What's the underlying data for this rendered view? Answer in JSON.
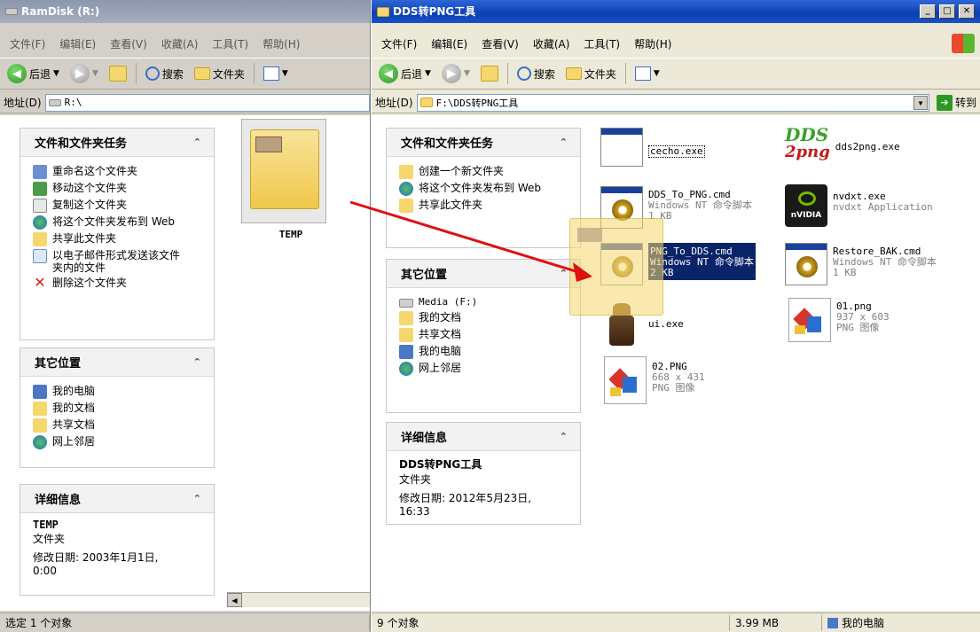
{
  "left_window": {
    "title": "RamDisk (R:)",
    "menu": [
      "文件(F)",
      "编辑(E)",
      "查看(V)",
      "收藏(A)",
      "工具(T)",
      "帮助(H)"
    ],
    "toolbar": {
      "back": "后退",
      "search": "搜索",
      "folders": "文件夹"
    },
    "address_label": "地址(D)",
    "address": "R:\\",
    "tasks_panel": {
      "title": "文件和文件夹任务",
      "items": [
        "重命名这个文件夹",
        "移动这个文件夹",
        "复制这个文件夹",
        "将这个文件夹发布到 Web",
        "共享此文件夹",
        "以电子邮件形式发送该文件夹内的文件",
        "删除这个文件夹"
      ]
    },
    "places_panel": {
      "title": "其它位置",
      "items": [
        "我的电脑",
        "我的文档",
        "共享文档",
        "网上邻居"
      ]
    },
    "details_panel": {
      "title": "详细信息",
      "name": "TEMP",
      "type": "文件夹",
      "modified": "修改日期: 2003年1月1日, 0:00"
    },
    "folder_label": "TEMP",
    "status": "选定 1 个对象"
  },
  "right_window": {
    "title": "DDS转PNG工具",
    "menu": [
      "文件(F)",
      "编辑(E)",
      "查看(V)",
      "收藏(A)",
      "工具(T)",
      "帮助(H)"
    ],
    "toolbar": {
      "back": "后退",
      "search": "搜索",
      "folders": "文件夹"
    },
    "address_label": "地址(D)",
    "address": "F:\\DDS转PNG工具",
    "go_label": "转到",
    "tasks_panel": {
      "title": "文件和文件夹任务",
      "items": [
        "创建一个新文件夹",
        "将这个文件夹发布到 Web",
        "共享此文件夹"
      ]
    },
    "places_panel": {
      "title": "其它位置",
      "items": [
        "Media (F:)",
        "我的文档",
        "共享文档",
        "我的电脑",
        "网上邻居"
      ]
    },
    "details_panel": {
      "title": "详细信息",
      "name": "DDS转PNG工具",
      "type": "文件夹",
      "modified": "修改日期: 2012年5月23日, 16:33"
    },
    "files": [
      {
        "name": "cecho.exe",
        "sub1": "",
        "sub2": ""
      },
      {
        "name": "dds2png.exe",
        "sub1": "",
        "sub2": ""
      },
      {
        "name": "DDS_To_PNG.cmd",
        "sub1": "Windows NT 命令脚本",
        "sub2": "1 KB"
      },
      {
        "name": "nvdxt.exe",
        "sub1": "nvdxt Application",
        "sub2": ""
      },
      {
        "name": "PNG_To_DDS.cmd",
        "sub1": "Windows NT 命令脚本",
        "sub2": "2 KB"
      },
      {
        "name": "Restore_BAK.cmd",
        "sub1": "Windows NT 命令脚本",
        "sub2": "1 KB"
      },
      {
        "name": "ui.exe",
        "sub1": "",
        "sub2": ""
      },
      {
        "name": "01.png",
        "sub1": "937 x 603",
        "sub2": "PNG 图像"
      },
      {
        "name": "02.PNG",
        "sub1": "668 x 431",
        "sub2": "PNG 图像"
      }
    ],
    "dds_logo_text": "DDS",
    "png_logo_text": "2png",
    "nvidia_text": "nVIDIA",
    "status_count": "9 个对象",
    "status_size": "3.99 MB",
    "status_location": "我的电脑"
  },
  "colors": {
    "accent": "#0a3fb4",
    "selection": "#0a246a",
    "drag_arrow": "#e01010"
  }
}
